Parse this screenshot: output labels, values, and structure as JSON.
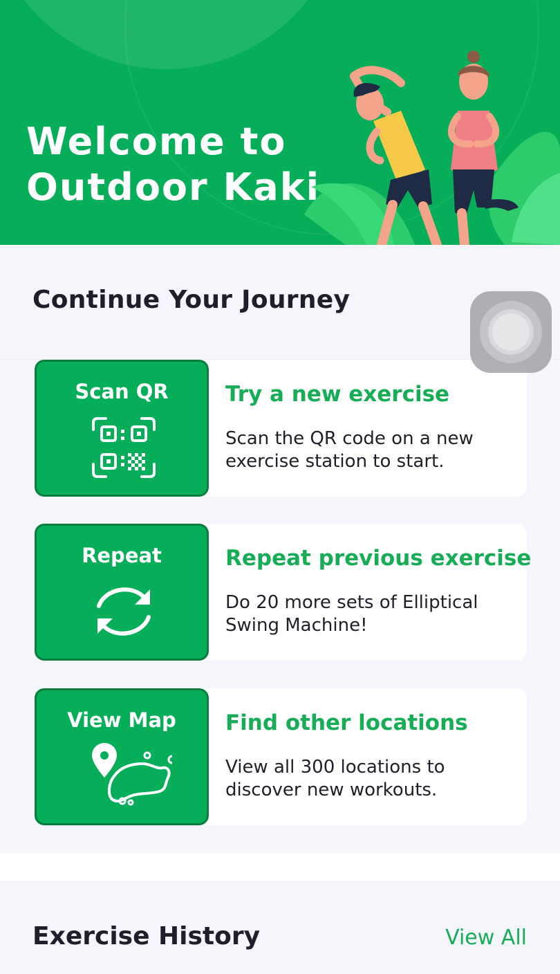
{
  "hero": {
    "title_line1": "Welcome to",
    "title_line2": "Outdoor Kaki"
  },
  "journey": {
    "title": "Continue Your Journey",
    "cards": [
      {
        "tile_label": "Scan QR",
        "icon": "qr-code-icon",
        "heading": "Try a new exercise",
        "description": "Scan the QR code on a new exercise station to start."
      },
      {
        "tile_label": "Repeat",
        "icon": "repeat-icon",
        "heading": "Repeat previous exercise",
        "description": "Do 20 more sets of Elliptical Swing Machine!"
      },
      {
        "tile_label": "View Map",
        "icon": "map-pin-icon",
        "heading": "Find other locations",
        "description": "View all 300 locations to discover new workouts."
      }
    ]
  },
  "history": {
    "title": "Exercise History",
    "view_all": "View All"
  },
  "colors": {
    "brand_green": "#06ae5a",
    "accent_text_green": "#17ad57",
    "tile_border": "#0a7d3f",
    "text_dark": "#1f1f2b"
  }
}
